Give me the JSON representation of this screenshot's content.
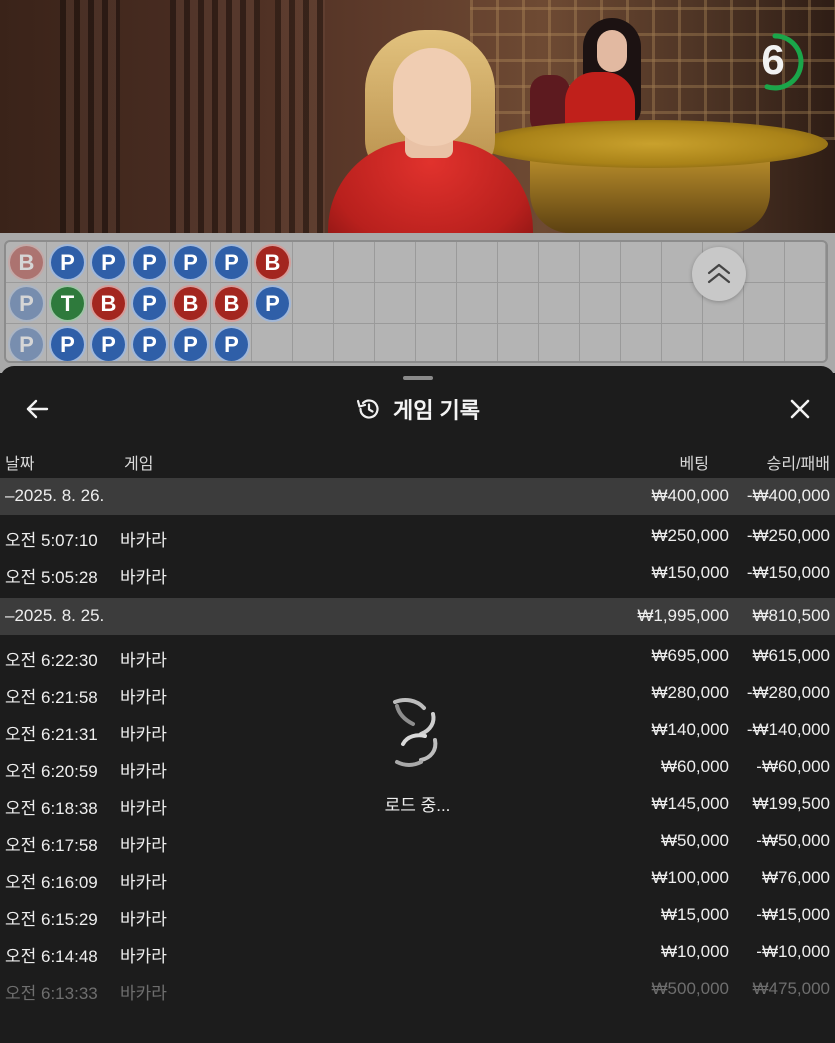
{
  "video": {
    "countdown": "6",
    "countdown_color": "#1aa64a",
    "countdown_fraction": 0.55
  },
  "roadmap": {
    "columns": [
      [
        {
          "r": "B",
          "faded": true
        },
        {
          "r": "P",
          "faded": true
        },
        {
          "r": "P",
          "faded": true
        }
      ],
      [
        {
          "r": "P"
        },
        {
          "r": "T"
        },
        {
          "r": "P"
        }
      ],
      [
        {
          "r": "P"
        },
        {
          "r": "B"
        },
        {
          "r": "P",
          "dot": "red"
        }
      ],
      [
        {
          "r": "P"
        },
        {
          "r": "P"
        },
        {
          "r": "P"
        }
      ],
      [
        {
          "r": "P",
          "dot": "blue"
        },
        {
          "r": "B",
          "dot": "red"
        },
        {
          "r": "P"
        }
      ],
      [
        {
          "r": "P"
        },
        {
          "r": "B"
        },
        {
          "r": "P"
        }
      ],
      [
        {
          "r": "B"
        },
        {
          "r": "P"
        },
        null
      ]
    ],
    "colors": {
      "P": "#2f5fa8",
      "B": "#a3261f",
      "T": "#2e7a3c"
    },
    "expand_icon": "double-chevron-up-icon"
  },
  "sheet": {
    "title": "게임 기록",
    "title_icon": "history-icon",
    "back_icon": "arrow-left-icon",
    "close_icon": "close-icon",
    "headers": {
      "date": "날짜",
      "game": "게임",
      "bet": "베팅",
      "win": "승리/패배"
    },
    "groups": [
      {
        "date": "–2025. 8. 26.",
        "bet": "₩400,000",
        "win": "-₩400,000",
        "rows": [
          {
            "time": "오전 5:07:10",
            "game": "바카라",
            "bet": "₩250,000",
            "win": "-₩250,000"
          },
          {
            "time": "오전 5:05:28",
            "game": "바카라",
            "bet": "₩150,000",
            "win": "-₩150,000"
          }
        ]
      },
      {
        "date": "–2025. 8. 25.",
        "bet": "₩1,995,000",
        "win": "₩810,500",
        "rows": [
          {
            "time": "오전 6:22:30",
            "game": "바카라",
            "bet": "₩695,000",
            "win": "₩615,000"
          },
          {
            "time": "오전 6:21:58",
            "game": "바카라",
            "bet": "₩280,000",
            "win": "-₩280,000"
          },
          {
            "time": "오전 6:21:31",
            "game": "바카라",
            "bet": "₩140,000",
            "win": "-₩140,000"
          },
          {
            "time": "오전 6:20:59",
            "game": "바카라",
            "bet": "₩60,000",
            "win": "-₩60,000"
          },
          {
            "time": "오전 6:18:38",
            "game": "바카라",
            "bet": "₩145,000",
            "win": "₩199,500"
          },
          {
            "time": "오전 6:17:58",
            "game": "바카라",
            "bet": "₩50,000",
            "win": "-₩50,000"
          },
          {
            "time": "오전 6:16:09",
            "game": "바카라",
            "bet": "₩100,000",
            "win": "₩76,000"
          },
          {
            "time": "오전 6:15:29",
            "game": "바카라",
            "bet": "₩15,000",
            "win": "-₩15,000"
          },
          {
            "time": "오전 6:14:48",
            "game": "바카라",
            "bet": "₩10,000",
            "win": "-₩10,000"
          },
          {
            "time": "오전 6:13:33",
            "game": "바카라",
            "bet": "₩500,000",
            "win": "₩475,000",
            "faded": true
          }
        ]
      }
    ],
    "loading_text": "로드 중..."
  }
}
